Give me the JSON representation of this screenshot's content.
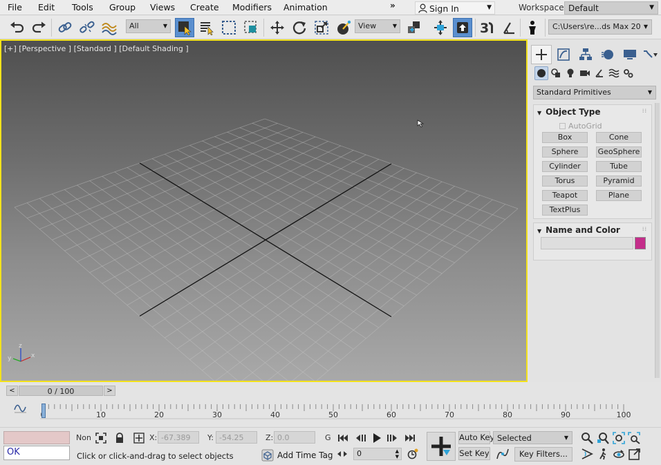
{
  "menubar": {
    "items": [
      "File",
      "Edit",
      "Tools",
      "Group",
      "Views",
      "Create",
      "Modifiers",
      "Animation"
    ],
    "expand": "»",
    "signin_label": "Sign In",
    "workspaces_label": "Workspaces:",
    "workspace_value": "Default"
  },
  "toolbar": {
    "selection_filter": "All",
    "ref_coord": "View",
    "project_path": "C:\\Users\\re...ds Max 2020"
  },
  "viewport": {
    "label": "[+] [Perspective ] [Standard ] [Default Shading ]",
    "border_color": "#f3e21b",
    "axis_x": "x",
    "axis_y": "y",
    "axis_z": "z"
  },
  "command_panel": {
    "category": "Standard Primitives",
    "object_type_title": "Object Type",
    "autogrid_label": "AutoGrid",
    "primitives": [
      "Box",
      "Cone",
      "Sphere",
      "GeoSphere",
      "Cylinder",
      "Tube",
      "Torus",
      "Pyramid",
      "Teapot",
      "Plane",
      "TextPlus"
    ],
    "name_color_title": "Name and Color",
    "object_color": "#c42e8a"
  },
  "time_slider": {
    "frame_display": "0 / 100",
    "prev": "<",
    "next": ">"
  },
  "track_bar": {
    "tick_labels": [
      "0",
      "10",
      "20",
      "30",
      "40",
      "50",
      "60",
      "70",
      "80",
      "90",
      "100"
    ],
    "current_frame": 0
  },
  "status": {
    "maxscript_text": "OK",
    "selection_count": "None Selected",
    "x_label": "X:",
    "x_value": "-67.389",
    "y_label": "Y:",
    "y_value": "-54.25",
    "z_label": "Z:",
    "z_value": "0.0",
    "grid_label": "G",
    "prompt": "Click or click-and-drag to select objects",
    "add_time_tag": "Add Time Tag",
    "current_frame": "0",
    "auto_key": "Auto Key",
    "set_key": "Set Key",
    "selected_filter": "Selected",
    "key_filters": "Key Filters..."
  }
}
